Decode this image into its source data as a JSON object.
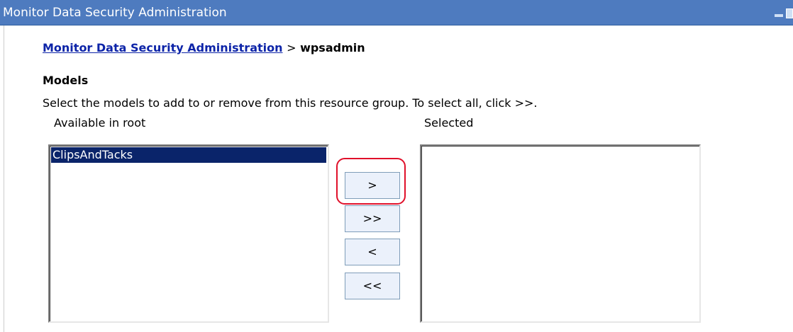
{
  "window": {
    "title": "Monitor Data Security Administration",
    "minimize_icon": "minimize-icon",
    "maximize_icon": "maximize-icon"
  },
  "breadcrumb": {
    "link_label": "Monitor Data Security Administration",
    "separator": ">",
    "current": "wpsadmin"
  },
  "models": {
    "title": "Models",
    "instructions": "Select the models to add to or remove from this resource group. To select all, click >>.",
    "available": {
      "label": "Available in root",
      "options": [
        "ClipsAndTacks"
      ],
      "selected_option": "ClipsAndTacks"
    },
    "selected": {
      "label": "Selected",
      "options": []
    },
    "buttons": {
      "add": ">",
      "add_all": ">>",
      "remove": "<",
      "remove_all": "<<"
    },
    "highlight_color": "#e0102a"
  },
  "colors": {
    "titlebar": "#4e7bbf",
    "link": "#0d24a8",
    "selection": "#0a246a",
    "button_bg": "#ebf1fb"
  }
}
